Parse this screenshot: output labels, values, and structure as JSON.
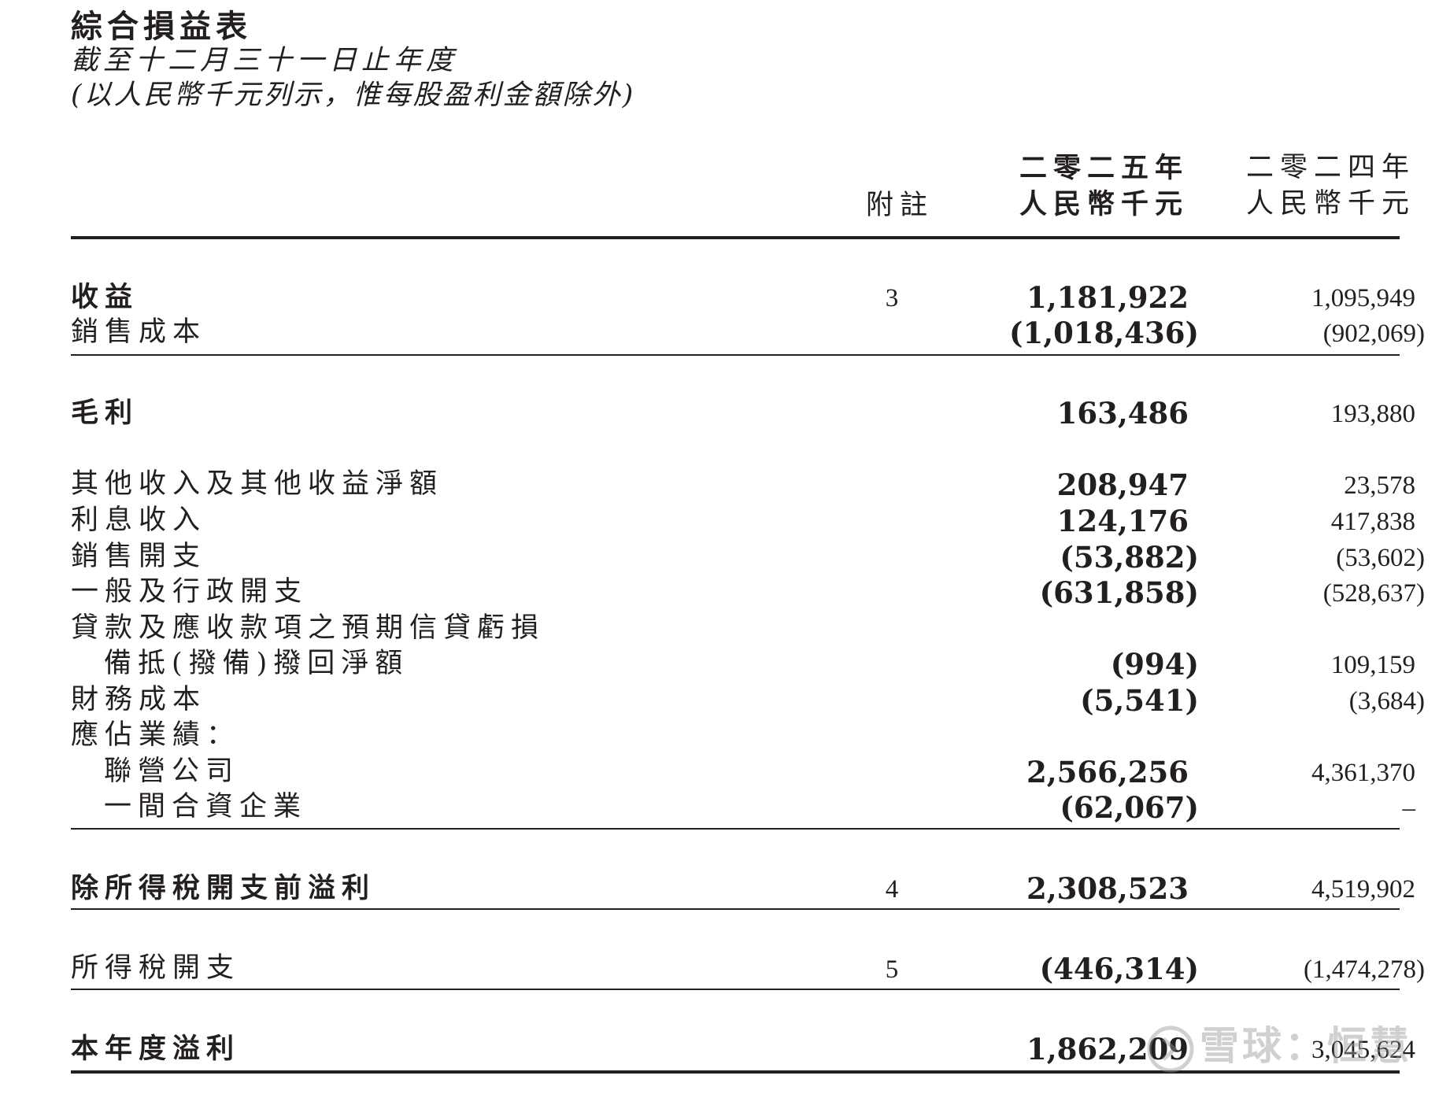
{
  "header": {
    "title": "綜合損益表",
    "subtitle": "截至十二月三十一日止年度",
    "unit_note": "(以人民幣千元列示，惟每股盈利金額除外)"
  },
  "columns": {
    "note": "附註",
    "y2025_year": "二零二五年",
    "y2025_unit": "人民幣千元",
    "y2024_year": "二零二四年",
    "y2024_unit": "人民幣千元"
  },
  "rows": [
    {
      "label": "收益",
      "note": "3",
      "y2025": "1,181,922",
      "y2024": "1,095,949"
    },
    {
      "label": "銷售成本",
      "note": "",
      "y2025": "(1,018,436)",
      "y2024": "(902,069)"
    },
    {
      "label": "毛利",
      "note": "",
      "y2025": "163,486",
      "y2024": "193,880"
    },
    {
      "label": "其他收入及其他收益淨額",
      "note": "",
      "y2025": "208,947",
      "y2024": "23,578"
    },
    {
      "label": "利息收入",
      "note": "",
      "y2025": "124,176",
      "y2024": "417,838"
    },
    {
      "label": "銷售開支",
      "note": "",
      "y2025": "(53,882)",
      "y2024": "(53,602)"
    },
    {
      "label": "一般及行政開支",
      "note": "",
      "y2025": "(631,858)",
      "y2024": "(528,637)"
    },
    {
      "label": "貸款及應收款項之預期信貸虧損",
      "note": "",
      "y2025": "",
      "y2024": ""
    },
    {
      "label": "備抵(撥備)撥回淨額",
      "note": "",
      "y2025": "(994)",
      "y2024": "109,159"
    },
    {
      "label": "財務成本",
      "note": "",
      "y2025": "(5,541)",
      "y2024": "(3,684)"
    },
    {
      "label": "應佔業績：",
      "note": "",
      "y2025": "",
      "y2024": ""
    },
    {
      "label": "聯營公司",
      "note": "",
      "y2025": "2,566,256",
      "y2024": "4,361,370"
    },
    {
      "label": "一間合資企業",
      "note": "",
      "y2025": "(62,067)",
      "y2024": "–"
    },
    {
      "label": "除所得稅開支前溢利",
      "note": "4",
      "y2025": "2,308,523",
      "y2024": "4,519,902"
    },
    {
      "label": "所得稅開支",
      "note": "5",
      "y2025": "(446,314)",
      "y2024": "(1,474,278)"
    },
    {
      "label": "本年度溢利",
      "note": "",
      "y2025": "1,862,209",
      "y2024": "3,045,624"
    }
  ],
  "watermark": {
    "text": "雪球：恒慧",
    "icon": "snowball-logo-icon"
  }
}
